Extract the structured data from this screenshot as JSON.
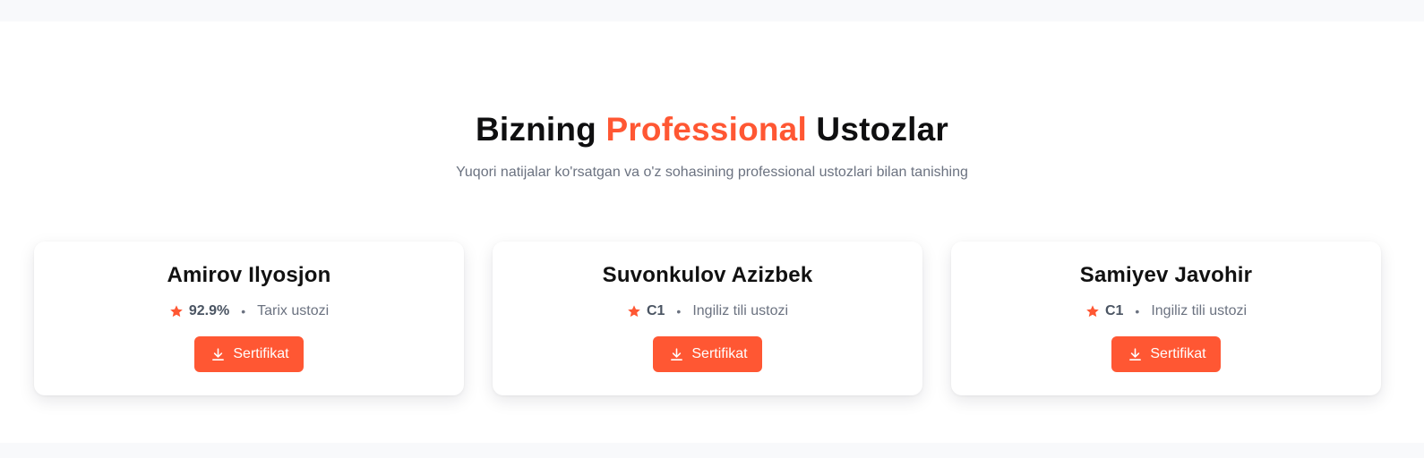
{
  "heading": {
    "part1": "Bizning",
    "accent": "Professional",
    "part2": "Ustozlar"
  },
  "subtitle": "Yuqori natijalar ko'rsatgan va o'z sohasining professional ustozlari bilan tanishing",
  "colors": {
    "accent": "#ff5733",
    "text": "#111111",
    "muted": "#6b7280"
  },
  "teachers": [
    {
      "name": "Amirov Ilyosjon",
      "score": "92.9%",
      "subject": "Tarix ustozi",
      "button_label": "Sertifikat",
      "icon": "star-icon"
    },
    {
      "name": "Suvonkulov Azizbek",
      "score": "C1",
      "subject": "Ingiliz tili ustozi",
      "button_label": "Sertifikat",
      "icon": "star-icon"
    },
    {
      "name": "Samiyev Javohir",
      "score": "C1",
      "subject": "Ingiliz tili ustozi",
      "button_label": "Sertifikat",
      "icon": "star-icon"
    }
  ]
}
